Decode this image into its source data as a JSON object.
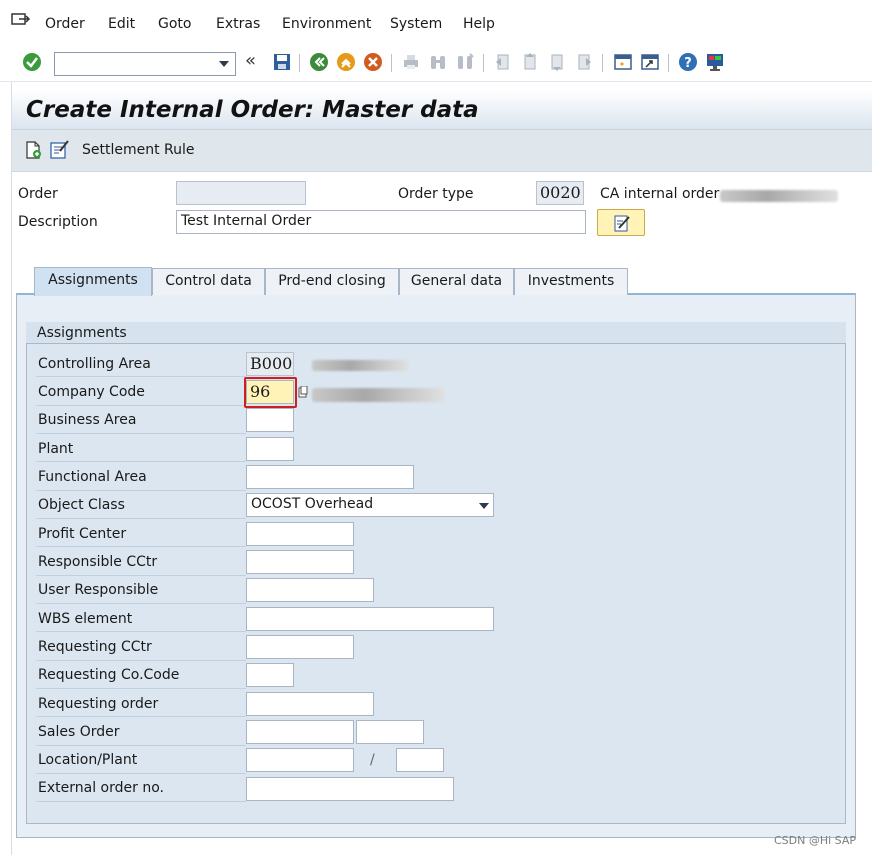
{
  "menu": {
    "items": [
      "Order",
      "Edit",
      "Goto",
      "Extras",
      "Environment",
      "System",
      "Help"
    ]
  },
  "toolbar": {
    "command_value": "",
    "icons": [
      "enter-icon",
      "save-icon",
      "back-icon",
      "exit-icon",
      "cancel-icon",
      "print-icon",
      "find-icon",
      "find-next-icon",
      "first-page-icon",
      "prev-page-icon",
      "next-page-icon",
      "last-page-icon",
      "create-session-icon",
      "shortcut-icon",
      "help-icon",
      "customize-layout-icon"
    ],
    "double_left": "«"
  },
  "title": "Create Internal Order: Master data",
  "app_toolbar": {
    "settlement_rule": "Settlement Rule"
  },
  "header": {
    "order_label": "Order",
    "order_value": "",
    "order_type_label": "Order type",
    "order_type_value": "0020",
    "order_type_text": "CA internal order -",
    "description_label": "Description",
    "description_value": "Test Internal Order"
  },
  "tabs": [
    {
      "label": "Assignments",
      "active": true
    },
    {
      "label": "Control data",
      "active": false
    },
    {
      "label": "Prd-end closing",
      "active": false
    },
    {
      "label": "General data",
      "active": false
    },
    {
      "label": "Investments",
      "active": false
    }
  ],
  "assignments": {
    "group_title": "Assignments",
    "fields": [
      {
        "label": "Controlling Area",
        "value": "B000"
      },
      {
        "label": "Company Code",
        "value": "96"
      },
      {
        "label": "Business Area",
        "value": ""
      },
      {
        "label": "Plant",
        "value": ""
      },
      {
        "label": "Functional Area",
        "value": ""
      },
      {
        "label": "Object Class",
        "value": "OCOST Overhead"
      },
      {
        "label": "Profit Center",
        "value": ""
      },
      {
        "label": "Responsible CCtr",
        "value": ""
      },
      {
        "label": "User Responsible",
        "value": ""
      },
      {
        "label": "WBS element",
        "value": ""
      },
      {
        "label": "Requesting CCtr",
        "value": ""
      },
      {
        "label": "Requesting Co.Code",
        "value": ""
      },
      {
        "label": "Requesting order",
        "value": ""
      },
      {
        "label": "Sales Order",
        "value": ""
      },
      {
        "label": "Location/Plant",
        "value": ""
      },
      {
        "label": "External order no.",
        "value": ""
      }
    ],
    "location_separator": "/"
  },
  "watermark": "CSDN @Hi SAP",
  "colors": {
    "title_gradient_bottom": "#dbe5ef",
    "tab_active": "#d0e1f1",
    "panel_bg": "#e7eef5",
    "focus_border": "#cf1f1f",
    "focus_fill": "#fff3b8"
  }
}
